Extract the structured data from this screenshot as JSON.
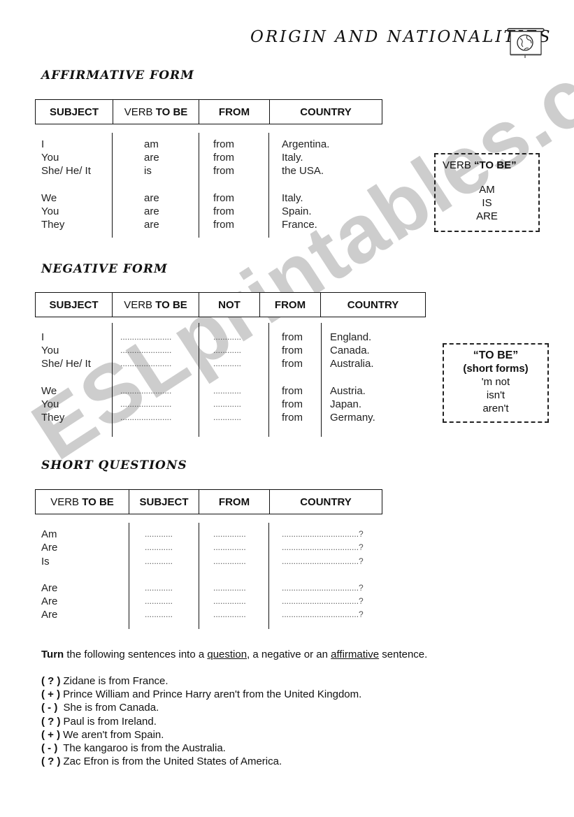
{
  "title": "ORIGIN AND NATIONALITIES",
  "title_icon": "globe-projector-screen-icon",
  "watermark": "ESLprintables.com",
  "affirmative": {
    "heading": "AFFIRMATIVE FORM",
    "columns": [
      {
        "light": "",
        "bold": "SUBJECT"
      },
      {
        "light": "VERB ",
        "bold": "TO BE"
      },
      {
        "light": "",
        "bold": "FROM"
      },
      {
        "light": "",
        "bold": "COUNTRY"
      }
    ],
    "rows": [
      {
        "subject": "I",
        "verb": "am",
        "from": "from",
        "country": "Argentina."
      },
      {
        "subject": "You",
        "verb": "are",
        "from": "from",
        "country": "Italy."
      },
      {
        "subject": "She/ He/ It",
        "verb": "is",
        "from": "from",
        "country": "the USA."
      },
      {
        "subject": "We",
        "verb": "are",
        "from": "from",
        "country": "Italy."
      },
      {
        "subject": "You",
        "verb": "are",
        "from": "from",
        "country": "Spain."
      },
      {
        "subject": "They",
        "verb": "are",
        "from": "from",
        "country": "France."
      }
    ]
  },
  "verb_box": {
    "title_light": "VERB ",
    "title_bold": "“TO BE”",
    "forms": [
      "AM",
      "IS",
      "ARE"
    ]
  },
  "negative": {
    "heading": "NEGATIVE FORM",
    "columns": [
      {
        "light": "",
        "bold": "SUBJECT"
      },
      {
        "light": "VERB ",
        "bold": "TO BE"
      },
      {
        "light": "",
        "bold": "NOT"
      },
      {
        "light": "",
        "bold": "FROM"
      },
      {
        "light": "",
        "bold": "COUNTRY"
      }
    ],
    "blank_long": "......................",
    "blank_short": "............",
    "rows": [
      {
        "subject": "I",
        "from": "from",
        "country": "England."
      },
      {
        "subject": "You",
        "from": "from",
        "country": "Canada."
      },
      {
        "subject": "She/ He/ It",
        "from": "from",
        "country": "Australia."
      },
      {
        "subject": "We",
        "from": "from",
        "country": "Austria."
      },
      {
        "subject": "You",
        "from": "from",
        "country": "Japan."
      },
      {
        "subject": "They",
        "from": "from",
        "country": "Germany."
      }
    ]
  },
  "short_forms_box": {
    "title": "“TO BE”",
    "subtitle": "(short forms)",
    "forms": [
      "'m not",
      "isn't",
      "aren't"
    ]
  },
  "questions": {
    "heading": "SHORT QUESTIONS",
    "columns": [
      {
        "light": "VERB ",
        "bold": "TO BE"
      },
      {
        "light": "",
        "bold": "SUBJECT"
      },
      {
        "light": "",
        "bold": "FROM"
      },
      {
        "light": "",
        "bold": "COUNTRY"
      }
    ],
    "blank_subject": "............",
    "blank_from": "..............",
    "blank_country": ".................................?",
    "rows": [
      "Am",
      "Are",
      "Is",
      "Are",
      "Are",
      "Are"
    ]
  },
  "exercise": {
    "instruction_bold": "Turn",
    "instruction_parts": [
      " the following sentences into a ",
      "question",
      ", a negative or an ",
      "affirmative",
      " sentence."
    ],
    "sentences": [
      {
        "mark": "( ? )",
        "text": "Zidane is from France."
      },
      {
        "mark": "( + )",
        "text": "Prince William and Prince Harry aren't from the United Kingdom."
      },
      {
        "mark": "( - )",
        "text": " She is from Canada."
      },
      {
        "mark": "( ? )",
        "text": "Paul is from Ireland."
      },
      {
        "mark": "( + )",
        "text": "We aren't from Spain."
      },
      {
        "mark": "( - )",
        "text": " The kangaroo is from the Australia."
      },
      {
        "mark": "( ? )",
        "text": "Zac Efron is from the United States of America."
      }
    ]
  }
}
